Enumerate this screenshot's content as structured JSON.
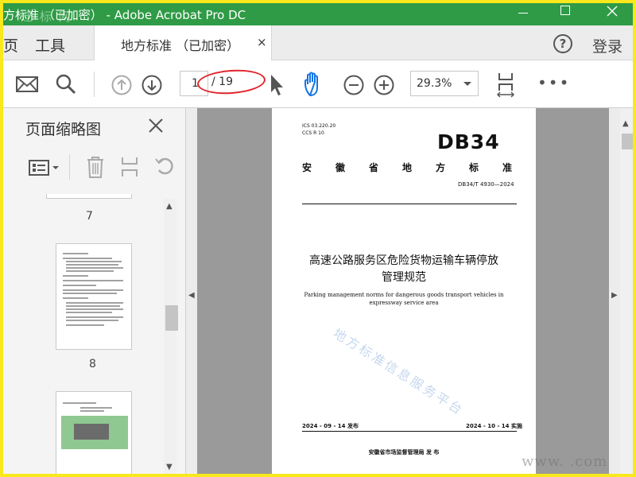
{
  "window": {
    "title": "方标准 （已加密） - Adobe Acrobat Pro DC",
    "watermark_logo": "迁 标 网"
  },
  "tabs": {
    "home": "页",
    "tools": "工具",
    "document": "地方标准 （已加密）",
    "close": "×",
    "help": "?",
    "login": "登录"
  },
  "toolbar": {
    "page_current": "1",
    "page_total": "/ 19",
    "zoom": "29.3%",
    "more": "•••",
    "highlight_color": "#e0242a"
  },
  "panel": {
    "title": "页面缩略图",
    "thumbnails": [
      {
        "label": "7"
      },
      {
        "label": "8"
      },
      {
        "label": ""
      }
    ]
  },
  "document_page": {
    "ics_line1": "ICS  03.220.20",
    "ics_line2": "CCS  R  10",
    "db": "DB34",
    "province_text": "安徽省地方标准",
    "standard_number": "DB34/T 4930—2024",
    "cn_title_line1": "高速公路服务区危险货物运输车辆停放",
    "cn_title_line2": "管理规范",
    "en_title": "Parking management norms for dangerous goods transport vehicles in expressway service area",
    "watermark": "地方标准信息服务平台",
    "publish_date": "2024 - 09 - 14 发布",
    "implement_date": "2024 - 10 - 14 实施",
    "issuer": "安徽省市场监督管理局    发  布"
  },
  "site_watermark": "www.     .com",
  "colors": {
    "titlebar": "#2f9b46",
    "border": "#f8e81c",
    "accent_blue": "#1473e6"
  }
}
